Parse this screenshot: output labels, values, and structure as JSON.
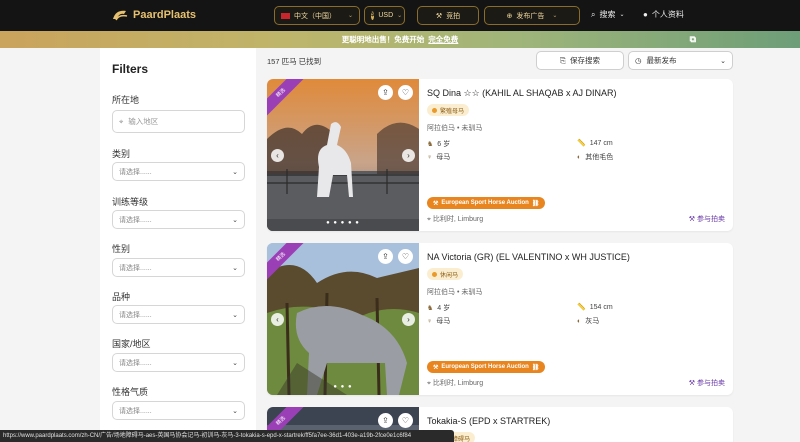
{
  "header": {
    "brand": "PaardPlaats",
    "language": "中文（中国）",
    "currency": "USD",
    "bid_label": "竞拍",
    "post_ad_label": "发布广告",
    "search_label": "搜索",
    "profile_label": "个人资料"
  },
  "banner": {
    "text": "更聪明地出售！免费开始",
    "link": "完全免费"
  },
  "filters": {
    "title": "Filters",
    "location_label": "所在地",
    "location_placeholder": "输入地区",
    "groups": [
      {
        "label": "类别",
        "value": "请选择......"
      },
      {
        "label": "训练等级",
        "value": "请选择......"
      },
      {
        "label": "性别",
        "value": "请选择......"
      },
      {
        "label": "品种",
        "value": "请选择......"
      },
      {
        "label": "国家/地区",
        "value": "请选择......"
      },
      {
        "label": "性格气质",
        "value": "请选择......"
      }
    ]
  },
  "results": {
    "count": "157 匹马 已找到",
    "save_search": "保存搜索",
    "sort": "最新发布"
  },
  "listings": [
    {
      "title": "SQ Dina ☆☆ (KAHIL AL SHAQAB x AJ DINAR)",
      "tag": "繁殖母马",
      "breed": "阿拉伯马 • 未驯马",
      "age": "6 岁",
      "height": "147 cm",
      "gender": "母马",
      "color": "其他毛色",
      "auction": "European Sport Horse Auction",
      "location": "比利时, Limburg",
      "bid": "参与拍卖"
    },
    {
      "title": "NA Victoria (GR) (EL VALENTINO x WH JUSTICE)",
      "tag": "休闲马",
      "breed": "阿拉伯马 • 未驯马",
      "age": "4 岁",
      "height": "154 cm",
      "gender": "母马",
      "color": "灰马",
      "auction": "European Sport Horse Auction",
      "location": "比利时, Limburg",
      "bid": "参与拍卖"
    },
    {
      "title": "Tokakia-S (EPD x STARTREK)",
      "tag": "场地障碍马"
    }
  ],
  "statusbar": {
    "url": "https://www.paardplaats.com/zh-CN/广告/场地障碍马-aes-英国马协会记马-初训马-灰马-3-tokakia-s-epd-x-startrek/ff5fa7ee-36d1-403e-a19b-2fce0e1c6f84"
  },
  "colors": {
    "header_bg": "#141414",
    "gold": "#e6c16f",
    "auction_orange": "#e8851f",
    "ribbon_purple": "#9b3fb6"
  }
}
